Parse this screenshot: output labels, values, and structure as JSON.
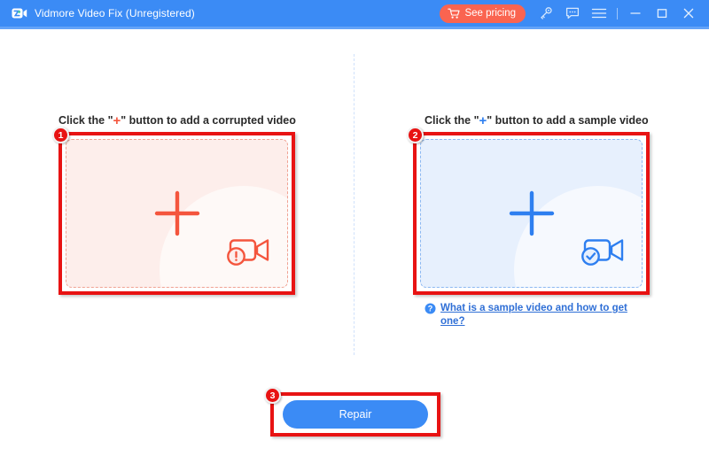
{
  "window": {
    "title": "Vidmore Video Fix (Unregistered)",
    "logo_icon": "video-camera-icon",
    "titlebar_color": "#3b8bf5"
  },
  "titlebar_actions": {
    "pricing": {
      "label": "See pricing",
      "icon": "shopping-cart-icon",
      "color": "#fa6450"
    },
    "register": {
      "icon": "key-icon",
      "tooltip": "Register"
    },
    "feedback": {
      "icon": "chat-bubble-icon",
      "tooltip": "Feedback"
    },
    "menu": {
      "icon": "hamburger-menu-icon",
      "tooltip": "Menu"
    },
    "minimize": {
      "icon": "minimize-icon"
    },
    "maximize": {
      "icon": "maximize-icon"
    },
    "close": {
      "icon": "close-icon"
    }
  },
  "main": {
    "corrupted": {
      "caption_before": "Click the \"",
      "caption_plus": "+",
      "caption_after": "\" button to add a corrupted video",
      "plus_icon": "plus-icon",
      "status_icon": "video-camera-warning-icon",
      "accent_color": "#f4553d",
      "zone_background": "#fdeeeb",
      "step_number": "1"
    },
    "sample": {
      "caption_before": "Click the \"",
      "caption_plus": "+",
      "caption_after": "\" button to add a sample video",
      "plus_icon": "plus-icon",
      "status_icon": "video-camera-check-icon",
      "accent_color": "#2e7ff0",
      "zone_background": "#e7f0fd",
      "step_number": "2",
      "help_icon": "question-mark-icon",
      "help_link": "What is a sample video and how to get one?"
    },
    "repair": {
      "label": "Repair",
      "color": "#3b8bf5",
      "step_number": "3"
    }
  },
  "annotation": {
    "highlight_color": "#e81313"
  }
}
